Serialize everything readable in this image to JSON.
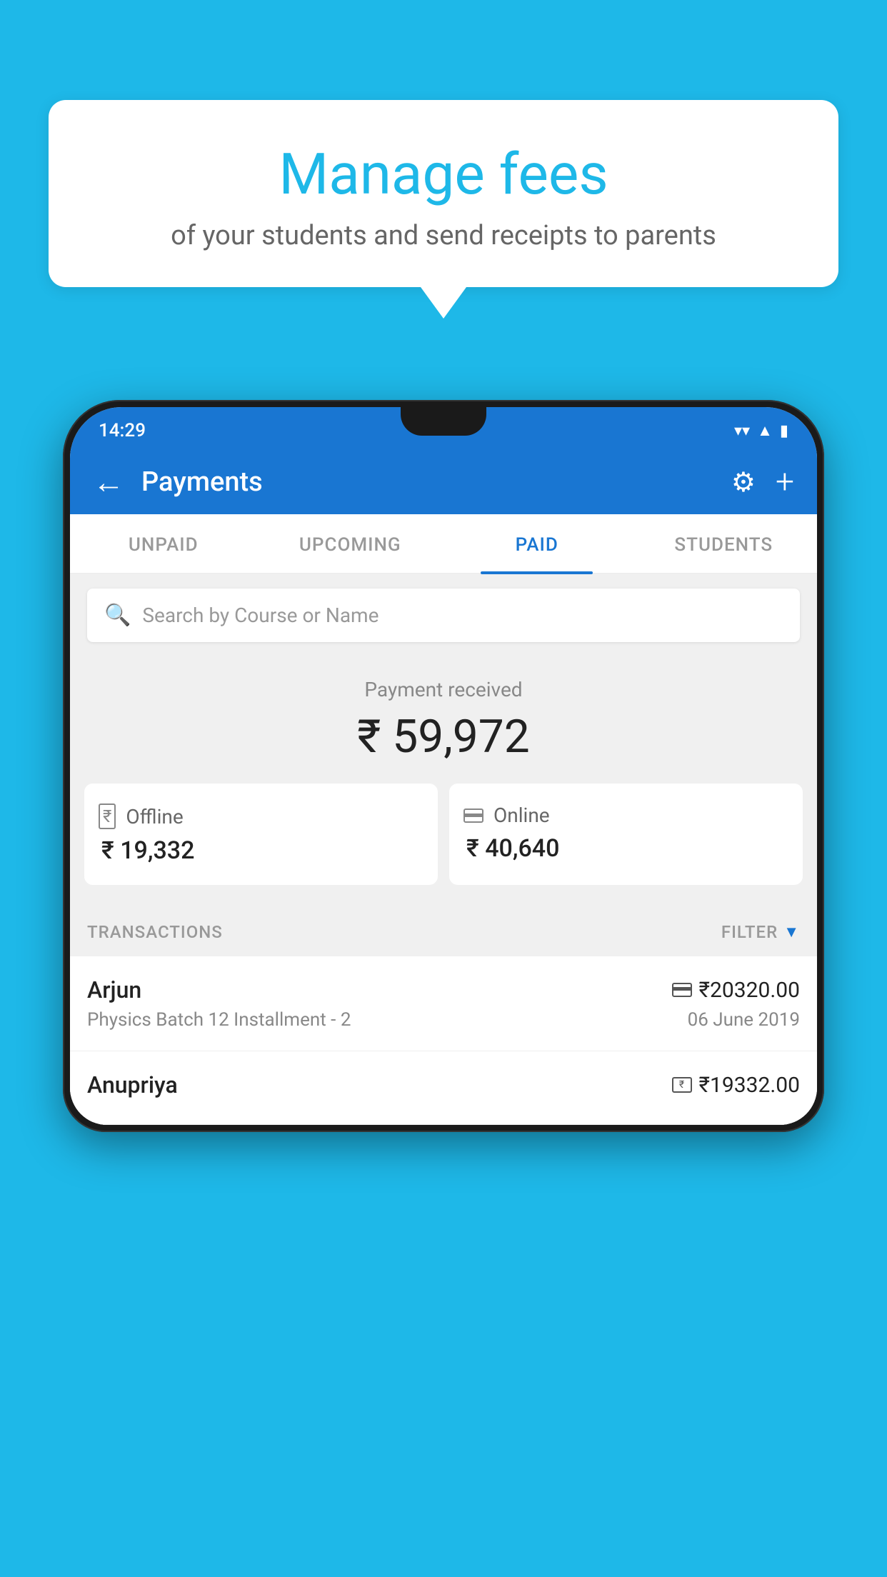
{
  "page": {
    "background_color": "#1eb8e8"
  },
  "bubble": {
    "title": "Manage fees",
    "subtitle": "of your students and send receipts to parents"
  },
  "status_bar": {
    "time": "14:29",
    "wifi": "▼",
    "signal": "▲",
    "battery": "▮"
  },
  "app_bar": {
    "title": "Payments",
    "back_icon": "←",
    "settings_icon": "⚙",
    "add_icon": "+"
  },
  "tabs": [
    {
      "label": "UNPAID",
      "active": false
    },
    {
      "label": "UPCOMING",
      "active": false
    },
    {
      "label": "PAID",
      "active": true
    },
    {
      "label": "STUDENTS",
      "active": false
    }
  ],
  "search": {
    "placeholder": "Search by Course or Name"
  },
  "payment_summary": {
    "label": "Payment received",
    "total": "₹ 59,972",
    "offline": {
      "label": "Offline",
      "amount": "₹ 19,332"
    },
    "online": {
      "label": "Online",
      "amount": "₹ 40,640"
    }
  },
  "transactions": {
    "header_label": "TRANSACTIONS",
    "filter_label": "FILTER",
    "rows": [
      {
        "name": "Arjun",
        "course": "Physics Batch 12 Installment - 2",
        "amount": "₹20320.00",
        "date": "06 June 2019",
        "payment_type": "card"
      },
      {
        "name": "Anupriya",
        "course": "",
        "amount": "₹19332.00",
        "date": "",
        "payment_type": "cash"
      }
    ]
  }
}
